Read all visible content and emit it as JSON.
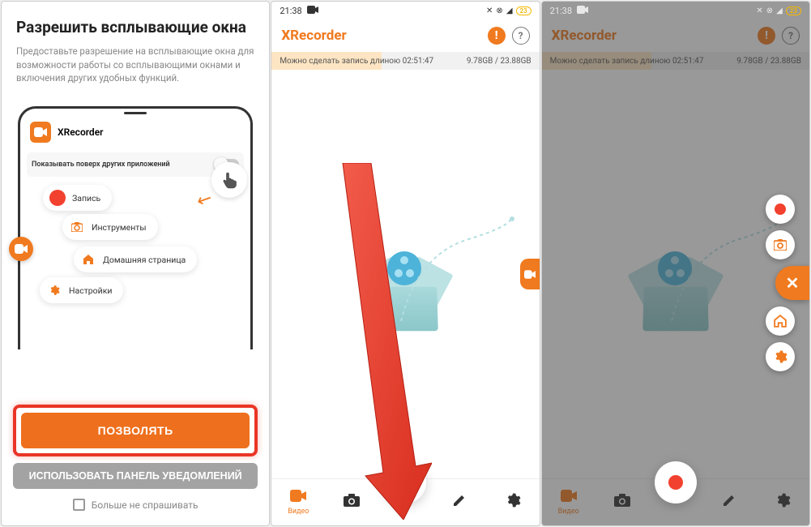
{
  "status": {
    "time": "21:38",
    "battery": "23"
  },
  "screen1": {
    "title": "Разрешить всплывающие окна",
    "description": "Предоставьте разрешение на всплывающие окна для возможности работы со всплывающими окнами и включения других удобных функций.",
    "app_name": "XRecorder",
    "overlay_label": "Показывать поверх других приложений",
    "bubbles": {
      "record": "Запись",
      "tools": "Инструменты",
      "home": "Домашняя страница",
      "settings": "Настройки"
    },
    "allow_btn": "ПОЗВОЛЯТЬ",
    "notif_btn": "ИСПОЛЬЗОВАТЬ ПАНЕЛЬ УВЕДОМЛЕНИЙ",
    "dont_ask": "Больше не спрашивать"
  },
  "app": {
    "logo": "Recorder",
    "storage_text": "Можно сделать запись длиною 02:51:47",
    "storage_size": "9.78GB / 23.88GB"
  },
  "nav": {
    "video": "Видео"
  }
}
